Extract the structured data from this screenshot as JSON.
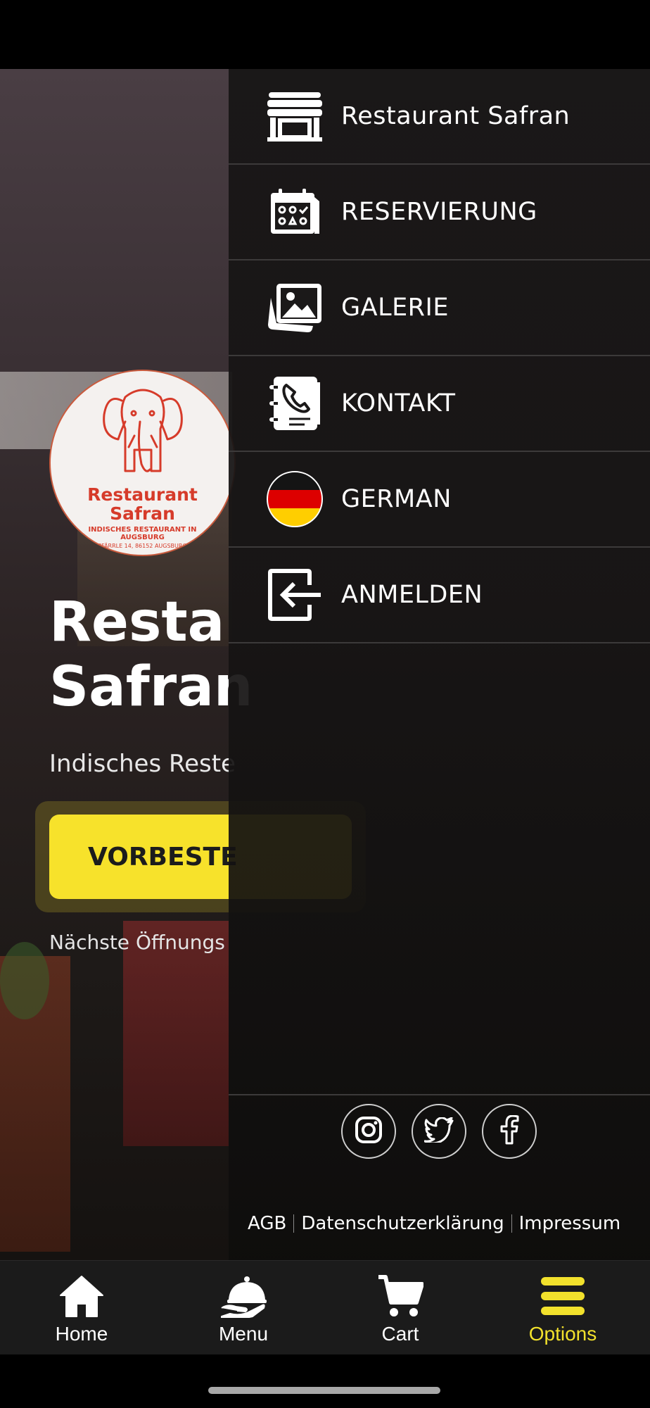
{
  "background": {
    "logo": {
      "name_line1": "Restaurant",
      "name_line2": "Safran",
      "tagline": "INDISCHES RESTAURANT IN AUGSBURG",
      "address": "PFÄRRLE 14, 86152 AUGSBURG"
    },
    "hero_title": "Resta\nSafran",
    "hero_subtitle": "Indisches Reste",
    "preorder_label": "VORBESTE",
    "next_opening": "Nächste Öffnungs"
  },
  "drawer": {
    "items": [
      {
        "label": "Restaurant Safran",
        "icon": "store-icon"
      },
      {
        "label": "RESERVIERUNG",
        "icon": "calendar-icon"
      },
      {
        "label": "GALERIE",
        "icon": "gallery-icon"
      },
      {
        "label": "KONTAKT",
        "icon": "contact-book-icon"
      },
      {
        "label": "GERMAN",
        "icon": "german-flag-icon"
      },
      {
        "label": "ANMELDEN",
        "icon": "login-icon"
      }
    ],
    "social": [
      "instagram-icon",
      "twitter-icon",
      "facebook-icon"
    ],
    "footer_links": [
      "AGB",
      "Datenschutzerklärung",
      "Impressum"
    ]
  },
  "bottom_nav": {
    "items": [
      {
        "label": "Home",
        "icon": "home-icon",
        "active": false
      },
      {
        "label": "Menu",
        "icon": "cloche-icon",
        "active": false
      },
      {
        "label": "Cart",
        "icon": "cart-icon",
        "active": false
      },
      {
        "label": "Options",
        "icon": "options-icon",
        "active": true
      }
    ],
    "active_color": "#f2e12c"
  },
  "colors": {
    "accent_yellow": "#f7e22b",
    "logo_red": "#d63b2a",
    "drawer_bg": "#181616"
  }
}
